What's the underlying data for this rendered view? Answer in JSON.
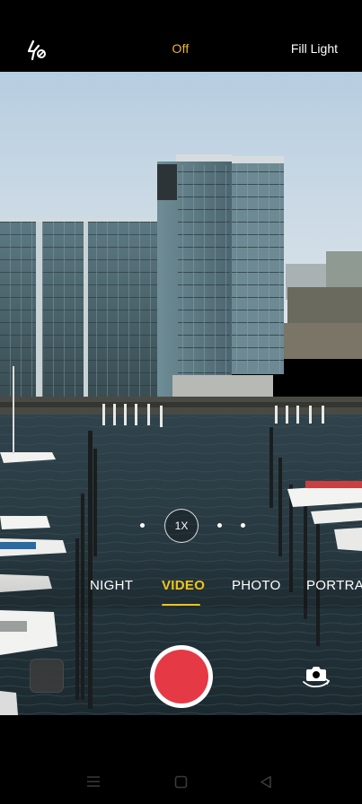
{
  "topbar": {
    "flash_icon": "flash-off-icon",
    "flash_state": "Off",
    "fill_light": "Fill Light"
  },
  "zoom": {
    "level": "1X"
  },
  "modes": [
    {
      "label": "NIGHT",
      "active": false
    },
    {
      "label": "VIDEO",
      "active": true
    },
    {
      "label": "PHOTO",
      "active": false
    },
    {
      "label": "PORTRAIT",
      "active": false
    }
  ],
  "controls": {
    "gallery_icon": "gallery-thumbnail",
    "shutter_icon": "record-icon",
    "switch_icon": "switch-camera-icon"
  },
  "navbar": {
    "menu_icon": "menu-icon",
    "home_icon": "home-icon",
    "back_icon": "back-icon"
  },
  "colors": {
    "accent": "#f0c419",
    "record": "#e63946",
    "flash_state": "#f0b633"
  }
}
